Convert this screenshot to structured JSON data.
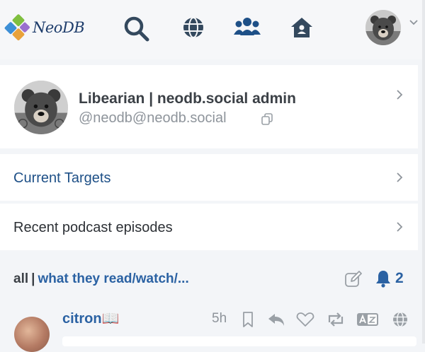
{
  "app": {
    "logo_text": "NeoDB"
  },
  "nav": {
    "icons": [
      "search-icon",
      "globe-icon",
      "users-icon",
      "home-icon"
    ],
    "avatar": "bear-avatar",
    "accent": "#1e5087"
  },
  "profile": {
    "name": "Libearian | neodb.social admin",
    "handle": "@neodb@neodb.social"
  },
  "menu": {
    "current_targets": "Current Targets",
    "recent_podcasts": "Recent podcast episodes"
  },
  "feed": {
    "scope": "all",
    "separator": "|",
    "title": "what they read/watch/...",
    "notification_count": "2"
  },
  "post": {
    "user": "citron📖",
    "time": "5h"
  }
}
